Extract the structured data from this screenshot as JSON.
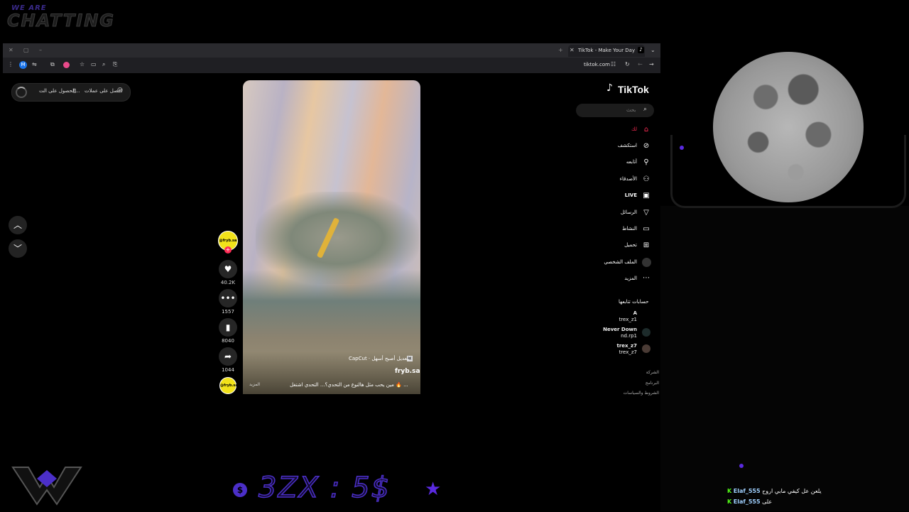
{
  "overlay": {
    "brand_top": "WE ARE",
    "brand_main": "CHATTING",
    "price_text": "3ZX : 5$",
    "colors": {
      "accent": "#5a2ae0",
      "kick_green": "#53fc18"
    }
  },
  "browser": {
    "tab_title": "TikTok - Make Your Day",
    "url": "tiktok.com",
    "profile_initial": "M"
  },
  "promo": {
    "get_coins": "احصل على عملات",
    "get_app": "الحصول على الت..."
  },
  "video": {
    "capcut_label": "CapCut · التعديل أصبح أسهل",
    "username": "fryb.sa",
    "caption": "مين يحب مثل هالنوع من التحدي؟... التحدي اشتغل 🔥 ...",
    "more": "المزيد"
  },
  "actions": {
    "likes": "40.2K",
    "comments": "1557",
    "saves": "8040",
    "shares": "1044",
    "avatar_text": "@fryb.sa"
  },
  "sidebar": {
    "logo": "TikTok",
    "search_placeholder": "بحث",
    "items": [
      {
        "label": "لك",
        "icon": "home-icon"
      },
      {
        "label": "استكشف",
        "icon": "compass-icon"
      },
      {
        "label": "أتابعه",
        "icon": "user-plus-icon"
      },
      {
        "label": "الأصدقاء",
        "icon": "friends-icon"
      },
      {
        "label": "LIVE",
        "icon": "live-icon"
      },
      {
        "label": "الرسائل",
        "icon": "send-icon"
      },
      {
        "label": "النشاط",
        "icon": "inbox-icon"
      },
      {
        "label": "تحميل",
        "icon": "upload-icon"
      },
      {
        "label": "الملف الشخصي",
        "icon": "profile-icon"
      },
      {
        "label": "المزيد",
        "icon": "more-icon"
      }
    ],
    "following_title": "حسابات تتابعها",
    "following": [
      {
        "name": "A",
        "handle": "trex_z1"
      },
      {
        "name": "Never Down",
        "handle": "nd.rp1"
      },
      {
        "name": "trex_z7",
        "handle": "trex_z7"
      }
    ],
    "footer": [
      "الشركة",
      "البرنامج",
      "الشروط والسياسات"
    ]
  },
  "chat": {
    "messages": [
      {
        "user": "Elaf_555",
        "text": "يلعن عل كيفي مابي اروح"
      },
      {
        "user": "Elaf_555",
        "text": "على"
      }
    ]
  }
}
